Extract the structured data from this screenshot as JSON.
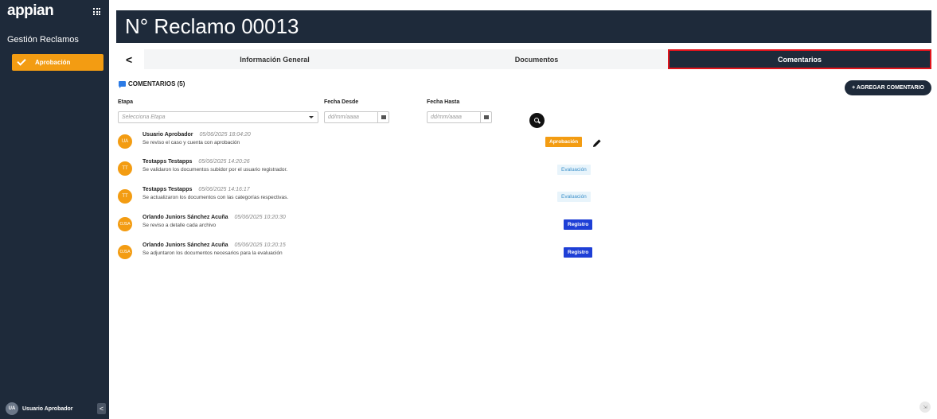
{
  "sidebar": {
    "logo": "appian",
    "app_name": "Gestión Reclamos",
    "items": [
      {
        "label": "Aprobación",
        "icon": "check-icon",
        "active": true
      }
    ],
    "user": {
      "initials": "UA",
      "name": "Usuario Aprobador"
    },
    "collapse_icon": "<"
  },
  "header": {
    "title": "N° Reclamo 00013"
  },
  "tabs": [
    {
      "label": "Información General",
      "active": false
    },
    {
      "label": "Documentos",
      "active": false
    },
    {
      "label": "Comentarios",
      "active": true
    }
  ],
  "back_icon": "<",
  "comments_section": {
    "title": "COMENTARIOS (5)",
    "add_button": "+ AGREGAR COMENTARIO"
  },
  "filters": {
    "etapa_label": "Etapa",
    "etapa_placeholder": "Selecciona Etapa",
    "desde_label": "Fecha Desde",
    "desde_placeholder": "dd/mm/aaaa",
    "hasta_label": "Fecha Hasta",
    "hasta_placeholder": "dd/mm/aaaa"
  },
  "comments": [
    {
      "initials": "UA",
      "author": "Usuario Aprobador",
      "date": "05/06/2025 18:04:20",
      "text": "Se reviso el caso y cuenta con aprobación",
      "stage": "Aprobación"
    },
    {
      "initials": "TT",
      "author": "Testapps Testapps",
      "date": "05/06/2025 14:20:26",
      "text": "Se validaron los documentos subidor por el usuario registrador.",
      "stage": "Evaluación"
    },
    {
      "initials": "TT",
      "author": "Testapps Testapps",
      "date": "05/06/2025 14:16:17",
      "text": "Se actualizaron los documentos con las categorías respectivas.",
      "stage": "Evaluación"
    },
    {
      "initials": "OJSA",
      "author": "Orlando Juniors Sánchez Acuña",
      "date": "05/06/2025 10:20:30",
      "text": "Se reviso a detalle cada archivo",
      "stage": "Registro"
    },
    {
      "initials": "OJSA",
      "author": "Orlando Juniors Sánchez Acuña",
      "date": "05/06/2025 10:20:15",
      "text": "Se adjuntaron los documentos necesarios para la evaluación",
      "stage": "Registro"
    }
  ],
  "colors": {
    "sidebar_bg": "#1e2a3a",
    "accent_orange": "#f39c12",
    "registro_blue": "#1e3fd6",
    "evaluacion_bg": "#e8f4fb",
    "active_tab_border": "#e0141c"
  }
}
